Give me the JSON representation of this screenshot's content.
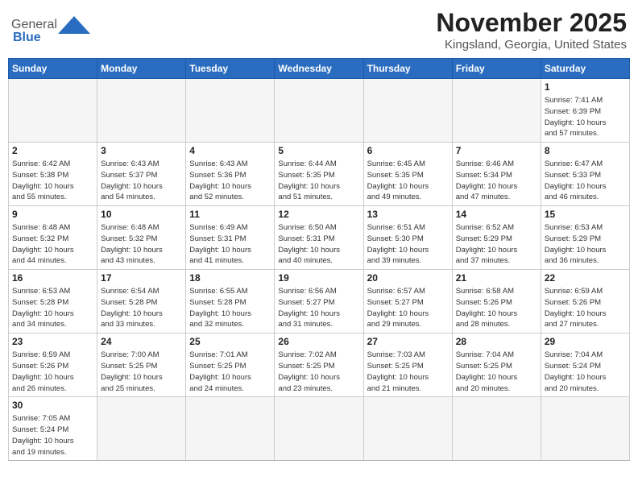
{
  "header": {
    "logo_general": "General",
    "logo_blue": "Blue",
    "month": "November 2025",
    "location": "Kingsland, Georgia, United States"
  },
  "days_of_week": [
    "Sunday",
    "Monday",
    "Tuesday",
    "Wednesday",
    "Thursday",
    "Friday",
    "Saturday"
  ],
  "weeks": [
    [
      {
        "day": "",
        "info": ""
      },
      {
        "day": "",
        "info": ""
      },
      {
        "day": "",
        "info": ""
      },
      {
        "day": "",
        "info": ""
      },
      {
        "day": "",
        "info": ""
      },
      {
        "day": "",
        "info": ""
      },
      {
        "day": "1",
        "info": "Sunrise: 7:41 AM\nSunset: 6:39 PM\nDaylight: 10 hours\nand 57 minutes."
      }
    ],
    [
      {
        "day": "2",
        "info": "Sunrise: 6:42 AM\nSunset: 5:38 PM\nDaylight: 10 hours\nand 55 minutes."
      },
      {
        "day": "3",
        "info": "Sunrise: 6:43 AM\nSunset: 5:37 PM\nDaylight: 10 hours\nand 54 minutes."
      },
      {
        "day": "4",
        "info": "Sunrise: 6:43 AM\nSunset: 5:36 PM\nDaylight: 10 hours\nand 52 minutes."
      },
      {
        "day": "5",
        "info": "Sunrise: 6:44 AM\nSunset: 5:35 PM\nDaylight: 10 hours\nand 51 minutes."
      },
      {
        "day": "6",
        "info": "Sunrise: 6:45 AM\nSunset: 5:35 PM\nDaylight: 10 hours\nand 49 minutes."
      },
      {
        "day": "7",
        "info": "Sunrise: 6:46 AM\nSunset: 5:34 PM\nDaylight: 10 hours\nand 47 minutes."
      },
      {
        "day": "8",
        "info": "Sunrise: 6:47 AM\nSunset: 5:33 PM\nDaylight: 10 hours\nand 46 minutes."
      }
    ],
    [
      {
        "day": "9",
        "info": "Sunrise: 6:48 AM\nSunset: 5:32 PM\nDaylight: 10 hours\nand 44 minutes."
      },
      {
        "day": "10",
        "info": "Sunrise: 6:48 AM\nSunset: 5:32 PM\nDaylight: 10 hours\nand 43 minutes."
      },
      {
        "day": "11",
        "info": "Sunrise: 6:49 AM\nSunset: 5:31 PM\nDaylight: 10 hours\nand 41 minutes."
      },
      {
        "day": "12",
        "info": "Sunrise: 6:50 AM\nSunset: 5:31 PM\nDaylight: 10 hours\nand 40 minutes."
      },
      {
        "day": "13",
        "info": "Sunrise: 6:51 AM\nSunset: 5:30 PM\nDaylight: 10 hours\nand 39 minutes."
      },
      {
        "day": "14",
        "info": "Sunrise: 6:52 AM\nSunset: 5:29 PM\nDaylight: 10 hours\nand 37 minutes."
      },
      {
        "day": "15",
        "info": "Sunrise: 6:53 AM\nSunset: 5:29 PM\nDaylight: 10 hours\nand 36 minutes."
      }
    ],
    [
      {
        "day": "16",
        "info": "Sunrise: 6:53 AM\nSunset: 5:28 PM\nDaylight: 10 hours\nand 34 minutes."
      },
      {
        "day": "17",
        "info": "Sunrise: 6:54 AM\nSunset: 5:28 PM\nDaylight: 10 hours\nand 33 minutes."
      },
      {
        "day": "18",
        "info": "Sunrise: 6:55 AM\nSunset: 5:28 PM\nDaylight: 10 hours\nand 32 minutes."
      },
      {
        "day": "19",
        "info": "Sunrise: 6:56 AM\nSunset: 5:27 PM\nDaylight: 10 hours\nand 31 minutes."
      },
      {
        "day": "20",
        "info": "Sunrise: 6:57 AM\nSunset: 5:27 PM\nDaylight: 10 hours\nand 29 minutes."
      },
      {
        "day": "21",
        "info": "Sunrise: 6:58 AM\nSunset: 5:26 PM\nDaylight: 10 hours\nand 28 minutes."
      },
      {
        "day": "22",
        "info": "Sunrise: 6:59 AM\nSunset: 5:26 PM\nDaylight: 10 hours\nand 27 minutes."
      }
    ],
    [
      {
        "day": "23",
        "info": "Sunrise: 6:59 AM\nSunset: 5:26 PM\nDaylight: 10 hours\nand 26 minutes."
      },
      {
        "day": "24",
        "info": "Sunrise: 7:00 AM\nSunset: 5:25 PM\nDaylight: 10 hours\nand 25 minutes."
      },
      {
        "day": "25",
        "info": "Sunrise: 7:01 AM\nSunset: 5:25 PM\nDaylight: 10 hours\nand 24 minutes."
      },
      {
        "day": "26",
        "info": "Sunrise: 7:02 AM\nSunset: 5:25 PM\nDaylight: 10 hours\nand 23 minutes."
      },
      {
        "day": "27",
        "info": "Sunrise: 7:03 AM\nSunset: 5:25 PM\nDaylight: 10 hours\nand 21 minutes."
      },
      {
        "day": "28",
        "info": "Sunrise: 7:04 AM\nSunset: 5:25 PM\nDaylight: 10 hours\nand 20 minutes."
      },
      {
        "day": "29",
        "info": "Sunrise: 7:04 AM\nSunset: 5:24 PM\nDaylight: 10 hours\nand 20 minutes."
      }
    ],
    [
      {
        "day": "30",
        "info": "Sunrise: 7:05 AM\nSunset: 5:24 PM\nDaylight: 10 hours\nand 19 minutes."
      },
      {
        "day": "",
        "info": ""
      },
      {
        "day": "",
        "info": ""
      },
      {
        "day": "",
        "info": ""
      },
      {
        "day": "",
        "info": ""
      },
      {
        "day": "",
        "info": ""
      },
      {
        "day": "",
        "info": ""
      }
    ]
  ]
}
